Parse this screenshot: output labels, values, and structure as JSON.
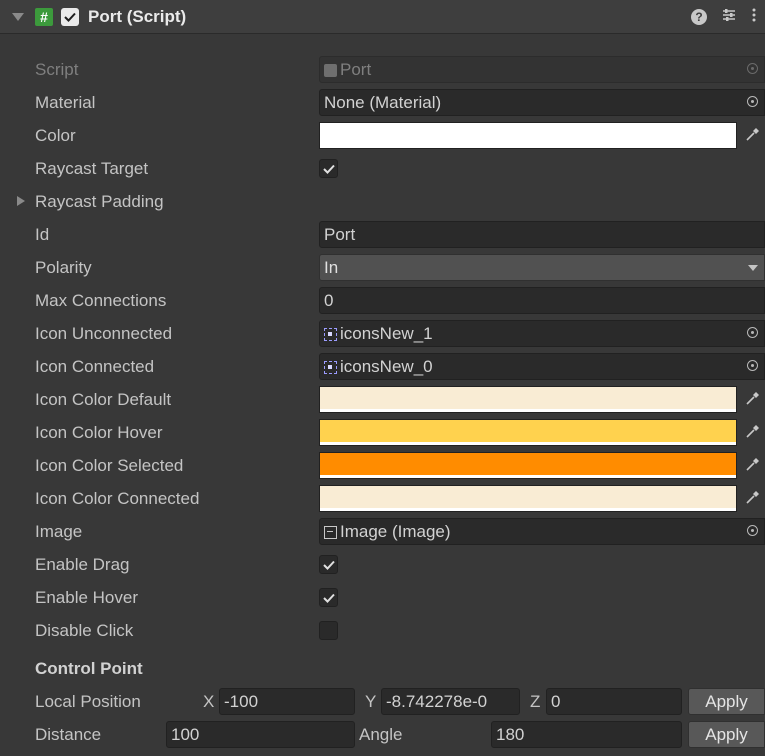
{
  "component": {
    "title": "Port (Script)",
    "enabled": true
  },
  "fields": {
    "script": {
      "label": "Script",
      "value": "Port"
    },
    "material": {
      "label": "Material",
      "value": "None (Material)"
    },
    "color": {
      "label": "Color",
      "value": "#ffffff"
    },
    "raycast_target": {
      "label": "Raycast Target",
      "checked": true
    },
    "raycast_padding": {
      "label": "Raycast Padding"
    },
    "id": {
      "label": "Id",
      "value": "Port"
    },
    "polarity": {
      "label": "Polarity",
      "value": "In"
    },
    "max_connections": {
      "label": "Max Connections",
      "value": "0"
    },
    "icon_unconnected": {
      "label": "Icon Unconnected",
      "value": "iconsNew_1"
    },
    "icon_connected": {
      "label": "Icon Connected",
      "value": "iconsNew_0"
    },
    "icon_color_default": {
      "label": "Icon Color Default",
      "value": "#f9ecd4"
    },
    "icon_color_hover": {
      "label": "Icon Color Hover",
      "value": "#ffd24e"
    },
    "icon_color_selected": {
      "label": "Icon Color Selected",
      "value": "#ff8c00"
    },
    "icon_color_connected": {
      "label": "Icon Color Connected",
      "value": "#f9ecd4"
    },
    "image": {
      "label": "Image",
      "value": "Image (Image)"
    },
    "enable_drag": {
      "label": "Enable Drag",
      "checked": true
    },
    "enable_hover": {
      "label": "Enable Hover",
      "checked": true
    },
    "disable_click": {
      "label": "Disable Click",
      "checked": false
    }
  },
  "control_point": {
    "title": "Control Point",
    "local_position": {
      "label": "Local Position",
      "x_label": "X",
      "x": "-100",
      "y_label": "Y",
      "y": "-8.742278e-0",
      "z_label": "Z",
      "z": "0",
      "apply": "Apply"
    },
    "distance": {
      "label": "Distance",
      "value": "100",
      "angle_label": "Angle",
      "angle": "180",
      "apply": "Apply"
    }
  },
  "icons": {
    "fold": "foldout-expanded-icon",
    "script": "script-icon",
    "help": "help-icon",
    "presets": "presets-icon",
    "menu": "context-menu-icon",
    "picker": "eyedropper-icon",
    "target": "object-picker-icon"
  }
}
